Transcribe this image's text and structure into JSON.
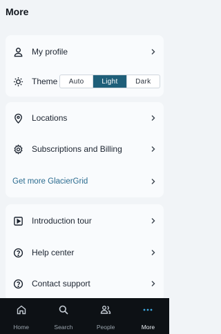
{
  "header": {
    "title": "More"
  },
  "account": {
    "profile_label": "My profile",
    "theme_label": "Theme",
    "theme_options": [
      "Auto",
      "Light",
      "Dark"
    ],
    "theme_selected": "Light"
  },
  "services": {
    "locations_label": "Locations",
    "billing_label": "Subscriptions and Billing",
    "upsell_label": "Get more GlacierGrid"
  },
  "support": {
    "tour_label": "Introduction tour",
    "help_label": "Help center",
    "contact_label": "Contact support"
  },
  "nav": {
    "items": [
      {
        "label": "Home",
        "icon": "home-icon"
      },
      {
        "label": "Search",
        "icon": "search-icon"
      },
      {
        "label": "People",
        "icon": "people-icon"
      },
      {
        "label": "More",
        "icon": "more-icon"
      }
    ],
    "active": "More"
  },
  "colors": {
    "accent": "#1f5f79",
    "link": "#2a6b8f",
    "nav_bg": "#0d1115",
    "nav_active_icon": "#3fa9e0"
  }
}
